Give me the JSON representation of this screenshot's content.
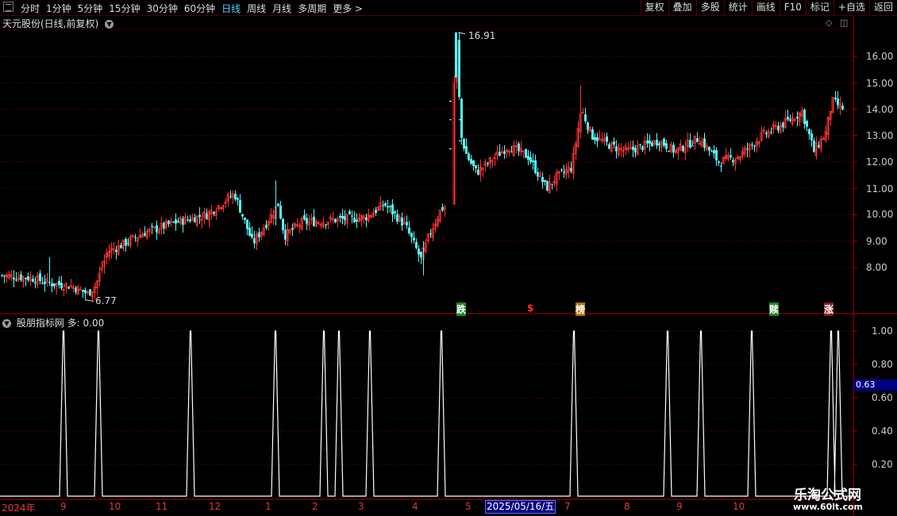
{
  "toolbar": {
    "periods": [
      "分时",
      "1分钟",
      "5分钟",
      "15分钟",
      "30分钟",
      "60分钟",
      "日线",
      "周线",
      "月线",
      "多周期",
      "更多 >"
    ],
    "active_period": "日线",
    "right_buttons": [
      "复权",
      "叠加",
      "多股",
      "统计",
      "画线",
      "F10",
      "标记",
      "+自选",
      "返回"
    ]
  },
  "main_panel": {
    "stock_title": "天元股份(日线,前复权)",
    "high_label": "16.91",
    "low_label": "6.77",
    "y_ticks": [
      "16.00",
      "15.00",
      "14.00",
      "13.00",
      "12.00",
      "11.00",
      "10.00",
      "9.00",
      "8.00"
    ],
    "signal_flags": [
      "跌",
      "$",
      "榜",
      "赎",
      "涨"
    ]
  },
  "indicator_panel": {
    "title": "股朋指标网 多: 0.00",
    "y_ticks": [
      "1.00",
      "0.80",
      "0.60",
      "0.40",
      "0.20"
    ],
    "current_value": "0.63"
  },
  "x_axis": {
    "labels": [
      "2024年",
      "9",
      "10",
      "11",
      "12",
      "1",
      "2",
      "3",
      "4",
      "5",
      "7",
      "8",
      "9",
      "10"
    ],
    "cursor_date": "2025/05/16/五"
  },
  "watermark": {
    "title": "乐淘公式网",
    "url": "www.60lt.com"
  },
  "chart_data": {
    "type": "candlestick",
    "price_range": [
      6.6,
      17.1
    ],
    "indicator_range": [
      0,
      1.05
    ],
    "indicator_spike_value": 1.0,
    "indicator_spikes_count": 17,
    "extremes": {
      "high": 16.91,
      "low": 6.77
    }
  },
  "colors": {
    "up": "#ff3232",
    "down": "#54fcfc",
    "grid": "#7a0000",
    "axis": "#b00000",
    "spike": "#ffffff"
  }
}
